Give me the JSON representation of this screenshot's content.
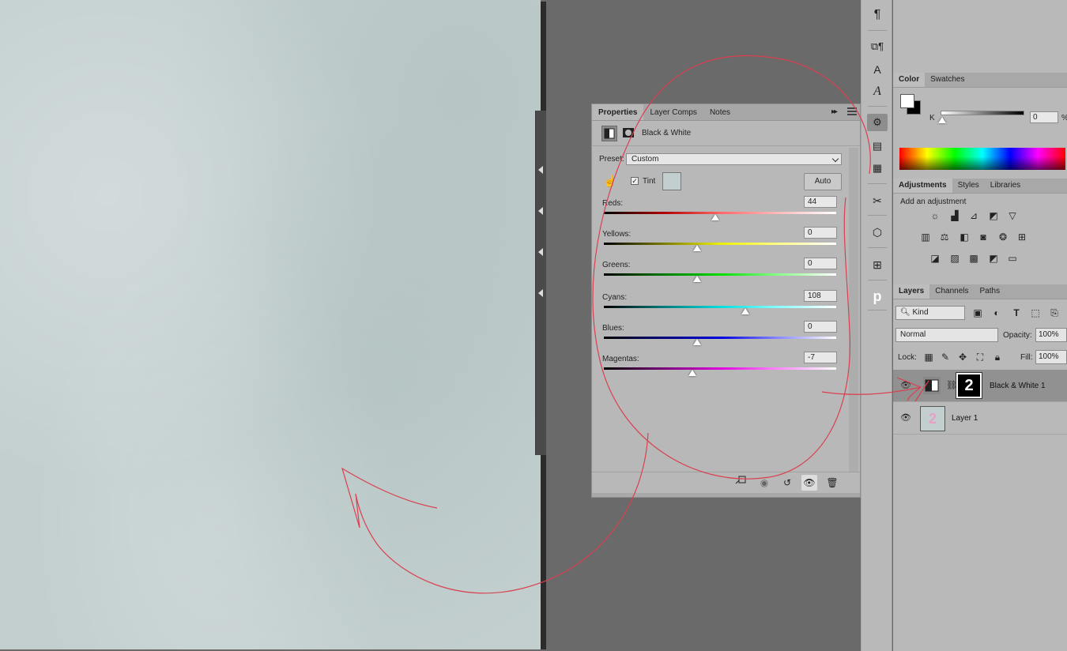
{
  "properties": {
    "tabs": [
      "Properties",
      "Layer Comps",
      "Notes"
    ],
    "title": "Black & White",
    "preset_label": "Preset:",
    "preset_value": "Custom",
    "tint_label": "Tint",
    "auto_label": "Auto",
    "sliders": [
      {
        "label": "Reds:",
        "value": "44",
        "level": 0.48
      },
      {
        "label": "Yellows:",
        "value": "0",
        "level": 0.4
      },
      {
        "label": "Greens:",
        "value": "0",
        "level": 0.4
      },
      {
        "label": "Cyans:",
        "value": "108",
        "level": 0.61
      },
      {
        "label": "Blues:",
        "value": "0",
        "level": 0.4
      },
      {
        "label": "Magentas:",
        "value": "-7",
        "level": 0.38
      }
    ]
  },
  "color": {
    "tabs": [
      "Color",
      "Swatches"
    ],
    "k_label": "K",
    "k_value": "0",
    "k_unit": "%"
  },
  "adjustments": {
    "tabs": [
      "Adjustments",
      "Styles",
      "Libraries"
    ],
    "hint": "Add an adjustment"
  },
  "layers": {
    "tabs": [
      "Layers",
      "Channels",
      "Paths"
    ],
    "filter_kind": "Kind",
    "blend_mode": "Normal",
    "opacity_label": "Opacity:",
    "opacity_value": "100%",
    "lock_label": "Lock:",
    "fill_label": "Fill:",
    "fill_value": "100%",
    "items": [
      {
        "name": "Black & White 1",
        "mask_text": "2",
        "selected": true
      },
      {
        "name": "Layer 1",
        "thumb_text": "2",
        "selected": false
      }
    ]
  },
  "colors": {
    "annotation": "#d94050",
    "canvas": "#c3cfcf"
  }
}
